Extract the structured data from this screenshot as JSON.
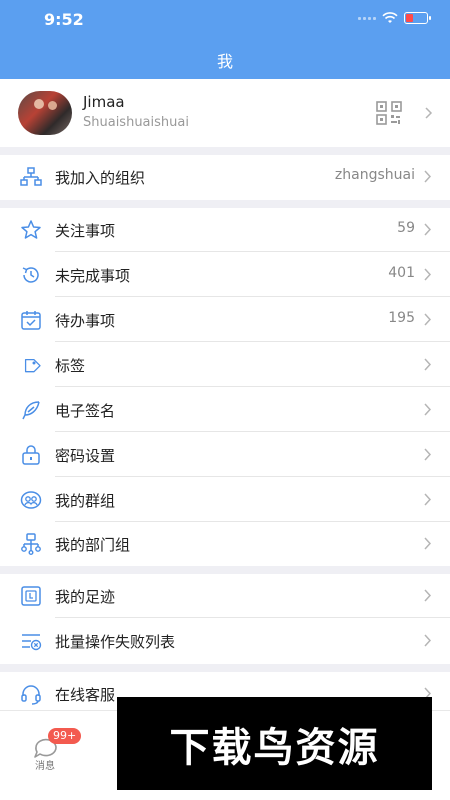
{
  "status_bar": {
    "time": "9:52"
  },
  "header": {
    "title": "我"
  },
  "profile": {
    "name": "Jimaa",
    "account": "Shuaishuaishuai"
  },
  "org": {
    "label": "我加入的组织",
    "value": "zhangshuai"
  },
  "menu": [
    {
      "label": "关注事项",
      "value": "59",
      "icon": "star-icon"
    },
    {
      "label": "未完成事项",
      "value": "401",
      "icon": "history-icon"
    },
    {
      "label": "待办事项",
      "value": "195",
      "icon": "calendar-check-icon"
    },
    {
      "label": "标签",
      "value": "",
      "icon": "tag-icon"
    },
    {
      "label": "电子签名",
      "value": "",
      "icon": "feather-icon"
    },
    {
      "label": "密码设置",
      "value": "",
      "icon": "lock-icon"
    },
    {
      "label": "我的群组",
      "value": "",
      "icon": "group-icon"
    },
    {
      "label": "我的部门组",
      "value": "",
      "icon": "department-icon"
    }
  ],
  "menu2": [
    {
      "label": "我的足迹",
      "icon": "footprint-icon"
    },
    {
      "label": "批量操作失败列表",
      "icon": "failed-list-icon"
    }
  ],
  "service": {
    "label": "在线客服",
    "icon": "headset-icon"
  },
  "tabbar": {
    "message_label": "消息",
    "message_badge": "99+"
  },
  "watermark": {
    "text": "下载鸟资源"
  },
  "colors": {
    "accent": "#5b9ff0",
    "badge": "#f35a4f"
  }
}
